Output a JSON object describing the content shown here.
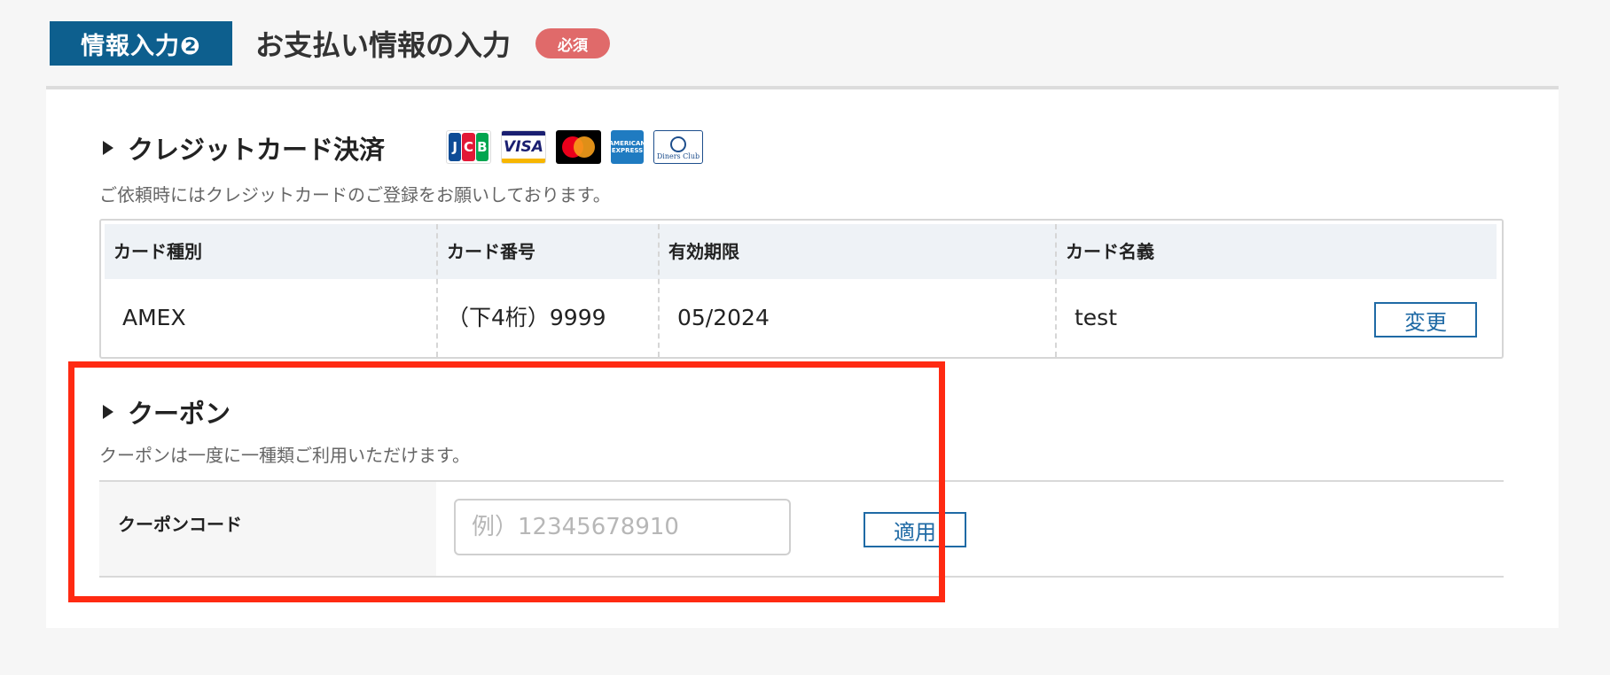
{
  "header": {
    "step_label": "情報入力❷",
    "title": "お支払い情報の入力",
    "required_badge": "必須"
  },
  "credit": {
    "heading": "クレジットカード決済",
    "note": "ご依頼時にはクレジットカードのご登録をお願いしております。",
    "brands": [
      "JCB",
      "VISA",
      "Mastercard",
      "AMERICAN EXPRESS",
      "Diners Club INTERNATIONAL"
    ],
    "table": {
      "headers": [
        "カード種別",
        "カード番号",
        "有効期限",
        "カード名義"
      ],
      "row": [
        "AMEX",
        "（下4桁）9999",
        "05/2024",
        "test"
      ]
    },
    "change_button": "変更"
  },
  "coupon": {
    "heading": "クーポン",
    "note": "クーポンは一度に一種類ご利用いただけます。",
    "field_label": "クーポンコード",
    "input_value": "",
    "input_placeholder": "例）12345678910",
    "apply_button": "適用"
  },
  "colors": {
    "brand_blue": "#0d5f8e",
    "required_red": "#e06a6a",
    "highlight_red": "#ff2a12",
    "button_blue": "#1f6aa5"
  }
}
